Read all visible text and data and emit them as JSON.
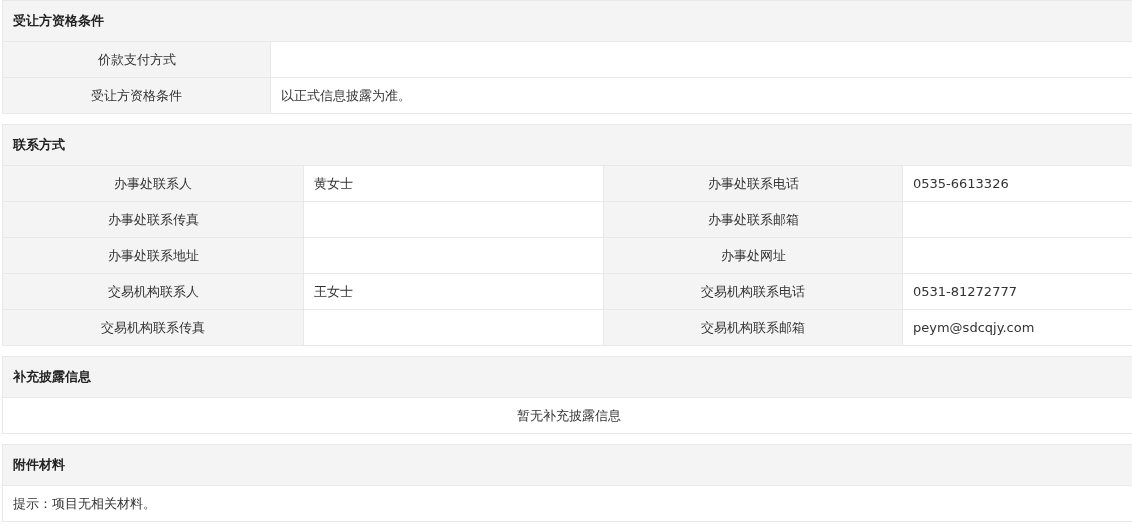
{
  "sections": [
    {
      "kind": "two_col",
      "title": "受让方资格条件",
      "rows": [
        {
          "label": "价款支付方式"
        },
        {
          "label": "受让方资格条件",
          "value": "以正式信息披露为准。"
        }
      ]
    },
    {
      "kind": "four_col",
      "title": "联系方式",
      "rows": [
        {
          "label_1": "办事处联系人",
          "value_1": "黄女士",
          "label_2": "办事处联系电话",
          "value_2": "0535-6613326"
        },
        {
          "label_1": "办事处联系传真",
          "label_2": "办事处联系邮箱"
        },
        {
          "label_1": "办事处联系地址",
          "label_2": "办事处网址"
        },
        {
          "label_1": "交易机构联系人",
          "value_1": "王女士",
          "label_2": "交易机构联系电话",
          "value_2": "0531-81272777"
        },
        {
          "label_1": "交易机构联系传真",
          "label_2": "交易机构联系邮箱",
          "value_2": "peym@sdcqjy.com"
        }
      ]
    },
    {
      "kind": "centered",
      "title": "补充披露信息",
      "text": "暂无补充披露信息"
    },
    {
      "kind": "note",
      "title": "附件材料",
      "text": "提示：项目无相关材料。"
    }
  ]
}
